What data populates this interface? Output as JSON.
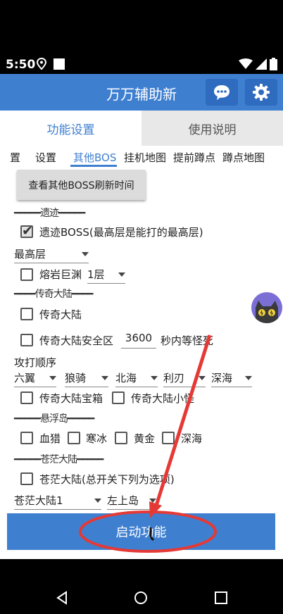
{
  "status_bar": {
    "time": "5:50"
  },
  "app_bar": {
    "title": "万万辅助新"
  },
  "tabs": {
    "function_settings": "功能设置",
    "instructions": "使用说明"
  },
  "sub_tabs": [
    "置",
    "设置",
    "其他BOS",
    "挂机地图",
    "提前蹲点",
    "蹲点地图"
  ],
  "check_boss_button": "查看其他BOSS刷新时间",
  "sections": {
    "relic": "━━━━━遗迹━━━━━",
    "legend_land": "━━━━传奇大陆━━━━",
    "floating_island": "━━━━━悬浮岛━━━━━",
    "vast_land": "━━━━━苍茫大陆━━━━━"
  },
  "relic_boss": {
    "label": "遗迹BOSS(最高层是能打的最高层)",
    "checked": true
  },
  "relic_floor_select": "最高层",
  "lava_abyss": {
    "label": "熔岩巨渊",
    "checked": false,
    "floor": "1层"
  },
  "legend_land": {
    "label": "传奇大陆",
    "checked": false
  },
  "legend_safe_zone": {
    "label": "传奇大陆安全区",
    "checked": false,
    "seconds": "3600",
    "suffix": "秒内等怪死"
  },
  "attack_order": {
    "label": "攻打顺序",
    "selects": [
      "六翼",
      "狼骑",
      "北海",
      "利刃",
      "深海"
    ]
  },
  "legend_treasure": {
    "label": "传奇大陆宝箱",
    "checked": false
  },
  "legend_minion": {
    "label": "传奇大陆小怪",
    "checked": false
  },
  "floating_items": [
    {
      "label": "血猎",
      "checked": false
    },
    {
      "label": "寒冰",
      "checked": false
    },
    {
      "label": "黄金",
      "checked": false
    },
    {
      "label": "深海",
      "checked": false
    }
  ],
  "vast_land": {
    "label": "苍茫大陆(总开关下列为选项)",
    "checked": false
  },
  "vast_selects": [
    "苍茫大陆1",
    "左上岛"
  ],
  "start_button": "启动功能",
  "colors": {
    "accent": "#3f7fd0",
    "annotation": "#e53935"
  }
}
